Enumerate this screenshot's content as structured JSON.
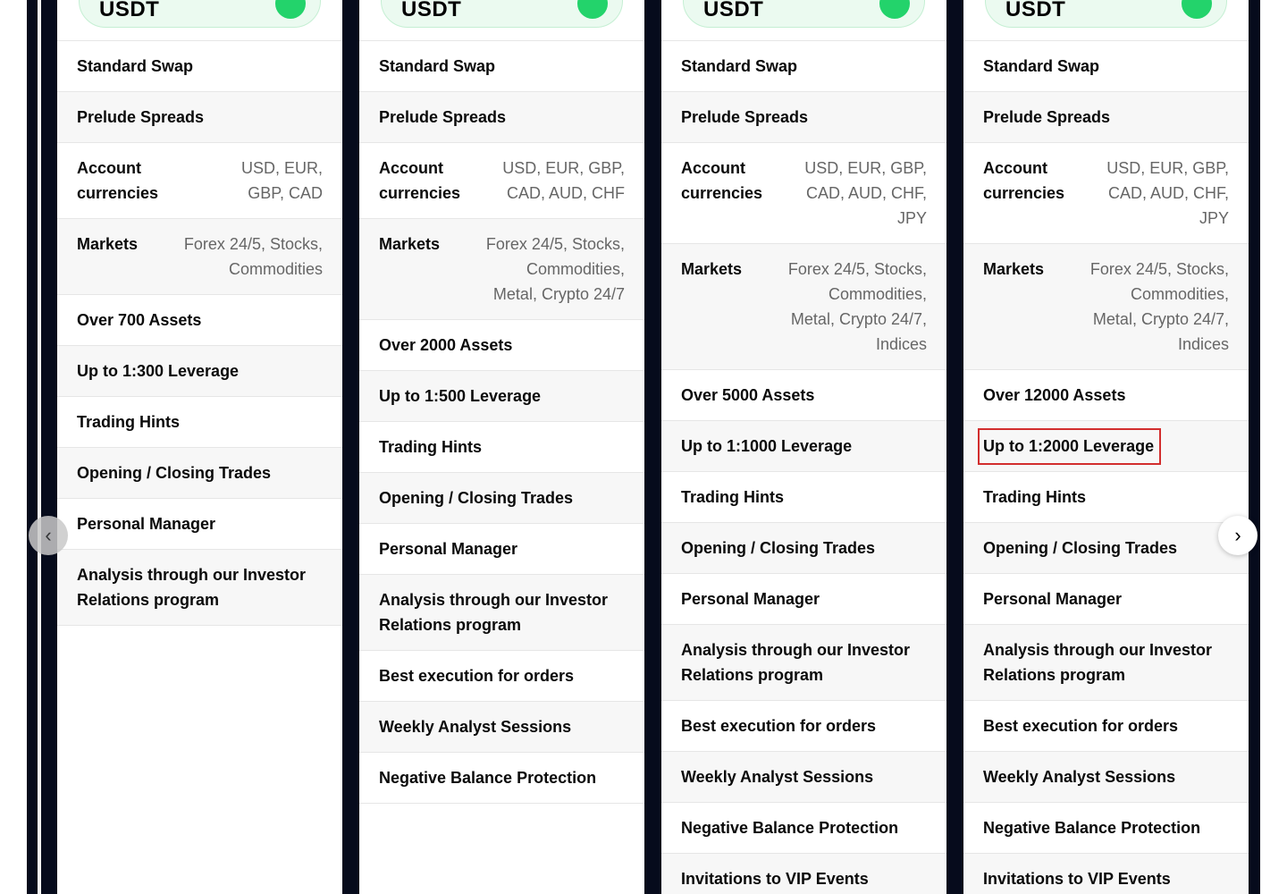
{
  "colors": {
    "background_frame": "#060b1c",
    "pill_bg": "#ebfaf0",
    "pill_dot": "#23d36b",
    "highlight": "#d22d2d"
  },
  "icons": {
    "prev": "chevron-left-icon",
    "next": "chevron-right-icon"
  },
  "prev_arrow": "‹",
  "next_arrow": "›",
  "columns": [
    {
      "header": "USDT",
      "rows": [
        {
          "name": "Standard Swap",
          "value": ""
        },
        {
          "name": "Prelude Spreads",
          "value": ""
        },
        {
          "name": "Account\ncurrencies",
          "value": "USD, EUR,\nGBP, CAD"
        },
        {
          "name": "Markets",
          "value": "Forex 24/5, Stocks,\nCommodities"
        },
        {
          "name": "Over 700 Assets",
          "value": ""
        },
        {
          "name": "Up to 1:300 Leverage",
          "value": ""
        },
        {
          "name": "Trading Hints",
          "value": ""
        },
        {
          "name": "Opening / Closing Trades",
          "value": ""
        },
        {
          "name": "Personal Manager",
          "value": ""
        },
        {
          "name": "Analysis through our Investor\nRelations program",
          "value": ""
        }
      ]
    },
    {
      "header": "USDT",
      "rows": [
        {
          "name": "Standard Swap",
          "value": ""
        },
        {
          "name": "Prelude Spreads",
          "value": ""
        },
        {
          "name": "Account\ncurrencies",
          "value": "USD, EUR, GBP,\nCAD, AUD, CHF"
        },
        {
          "name": "Markets",
          "value": "Forex 24/5, Stocks,\nCommodities,\nMetal, Crypto 24/7"
        },
        {
          "name": "Over 2000 Assets",
          "value": ""
        },
        {
          "name": "Up to 1:500 Leverage",
          "value": ""
        },
        {
          "name": "Trading Hints",
          "value": ""
        },
        {
          "name": "Opening / Closing Trades",
          "value": ""
        },
        {
          "name": "Personal Manager",
          "value": ""
        },
        {
          "name": "Analysis through our Investor\nRelations program",
          "value": ""
        },
        {
          "name": "Best execution for orders",
          "value": ""
        },
        {
          "name": "Weekly Analyst Sessions",
          "value": ""
        },
        {
          "name": "Negative Balance Protection",
          "value": ""
        }
      ]
    },
    {
      "header": "USDT",
      "rows": [
        {
          "name": "Standard Swap",
          "value": ""
        },
        {
          "name": "Prelude Spreads",
          "value": ""
        },
        {
          "name": "Account\ncurrencies",
          "value": "USD, EUR, GBP,\nCAD, AUD, CHF,\nJPY"
        },
        {
          "name": "Markets",
          "value": "Forex 24/5, Stocks,\nCommodities,\nMetal, Crypto 24/7,\nIndices"
        },
        {
          "name": "Over 5000 Assets",
          "value": ""
        },
        {
          "name": "Up to 1:1000 Leverage",
          "value": ""
        },
        {
          "name": "Trading Hints",
          "value": ""
        },
        {
          "name": "Opening / Closing Trades",
          "value": ""
        },
        {
          "name": "Personal Manager",
          "value": ""
        },
        {
          "name": "Analysis through our Investor\nRelations program",
          "value": ""
        },
        {
          "name": "Best execution for orders",
          "value": ""
        },
        {
          "name": "Weekly Analyst Sessions",
          "value": ""
        },
        {
          "name": "Negative Balance Protection",
          "value": ""
        },
        {
          "name": "Invitations to VIP Events",
          "value": ""
        }
      ]
    },
    {
      "header": "USDT",
      "rows": [
        {
          "name": "Standard Swap",
          "value": ""
        },
        {
          "name": "Prelude Spreads",
          "value": ""
        },
        {
          "name": "Account\ncurrencies",
          "value": "USD, EUR, GBP,\nCAD, AUD, CHF,\nJPY"
        },
        {
          "name": "Markets",
          "value": "Forex 24/5, Stocks,\nCommodities,\nMetal, Crypto 24/7,\nIndices"
        },
        {
          "name": "Over 12000 Assets",
          "value": ""
        },
        {
          "name": "Up to 1:2000 Leverage",
          "value": ""
        },
        {
          "name": "Trading Hints",
          "value": ""
        },
        {
          "name": "Opening / Closing Trades",
          "value": ""
        },
        {
          "name": "Personal Manager",
          "value": ""
        },
        {
          "name": "Analysis through our Investor\nRelations program",
          "value": ""
        },
        {
          "name": "Best execution for orders",
          "value": ""
        },
        {
          "name": "Weekly Analyst Sessions",
          "value": ""
        },
        {
          "name": "Negative Balance Protection",
          "value": ""
        },
        {
          "name": "Invitations to VIP Events",
          "value": ""
        }
      ]
    }
  ]
}
